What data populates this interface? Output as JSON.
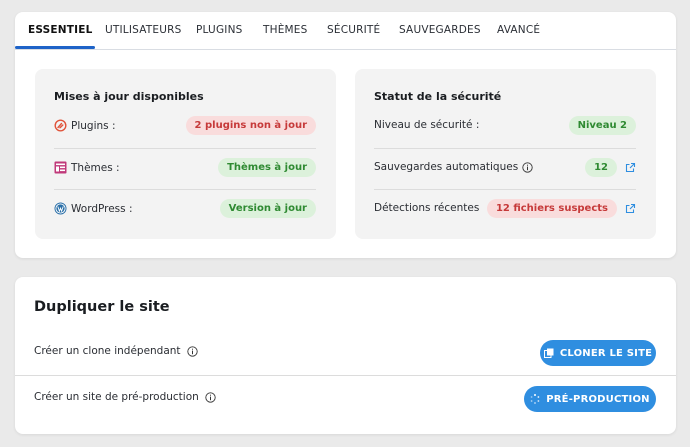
{
  "tabs": [
    {
      "label": "ESSENTIEL",
      "active": true
    },
    {
      "label": "UTILISATEURS"
    },
    {
      "label": "PLUGINS"
    },
    {
      "label": "THÈMES"
    },
    {
      "label": "SÉCURITÉ"
    },
    {
      "label": "SAUVEGARDES"
    },
    {
      "label": "AVANCÉ"
    }
  ],
  "updates": {
    "title": "Mises à jour disponibles",
    "rows": [
      {
        "label": "Plugins :",
        "icon": "plugin-icon",
        "status": "2 plugins non à jour",
        "tone": "red"
      },
      {
        "label": "Thèmes :",
        "icon": "themes-icon",
        "status": "Thèmes à jour",
        "tone": "green"
      },
      {
        "label": "WordPress :",
        "icon": "wordpress-icon",
        "status": "Version à jour",
        "tone": "green"
      }
    ]
  },
  "security": {
    "title": "Statut de la sécurité",
    "rows": [
      {
        "label": "Niveau de sécurité :",
        "status": "Niveau 2",
        "tone": "green"
      },
      {
        "label": "Sauvegardes automatiques",
        "status": "12",
        "tone": "green"
      },
      {
        "label": "Détections récentes",
        "status": "12 fichiers suspects",
        "tone": "red"
      }
    ]
  },
  "duplicate": {
    "title": "Dupliquer le site",
    "rows": [
      {
        "label": "Créer un clone indépendant",
        "button": "CLONER LE SITE"
      },
      {
        "label": "Créer un site de pré-production",
        "button": "PRÉ-PRODUCTION"
      }
    ]
  },
  "colors": {
    "accent": "#1e63c8",
    "button": "#2f8ee0",
    "ok_bg": "#dcf1db",
    "ok_text": "#2f8a32",
    "alert_bg": "#f9dcdc",
    "alert_text": "#c63a3a"
  }
}
